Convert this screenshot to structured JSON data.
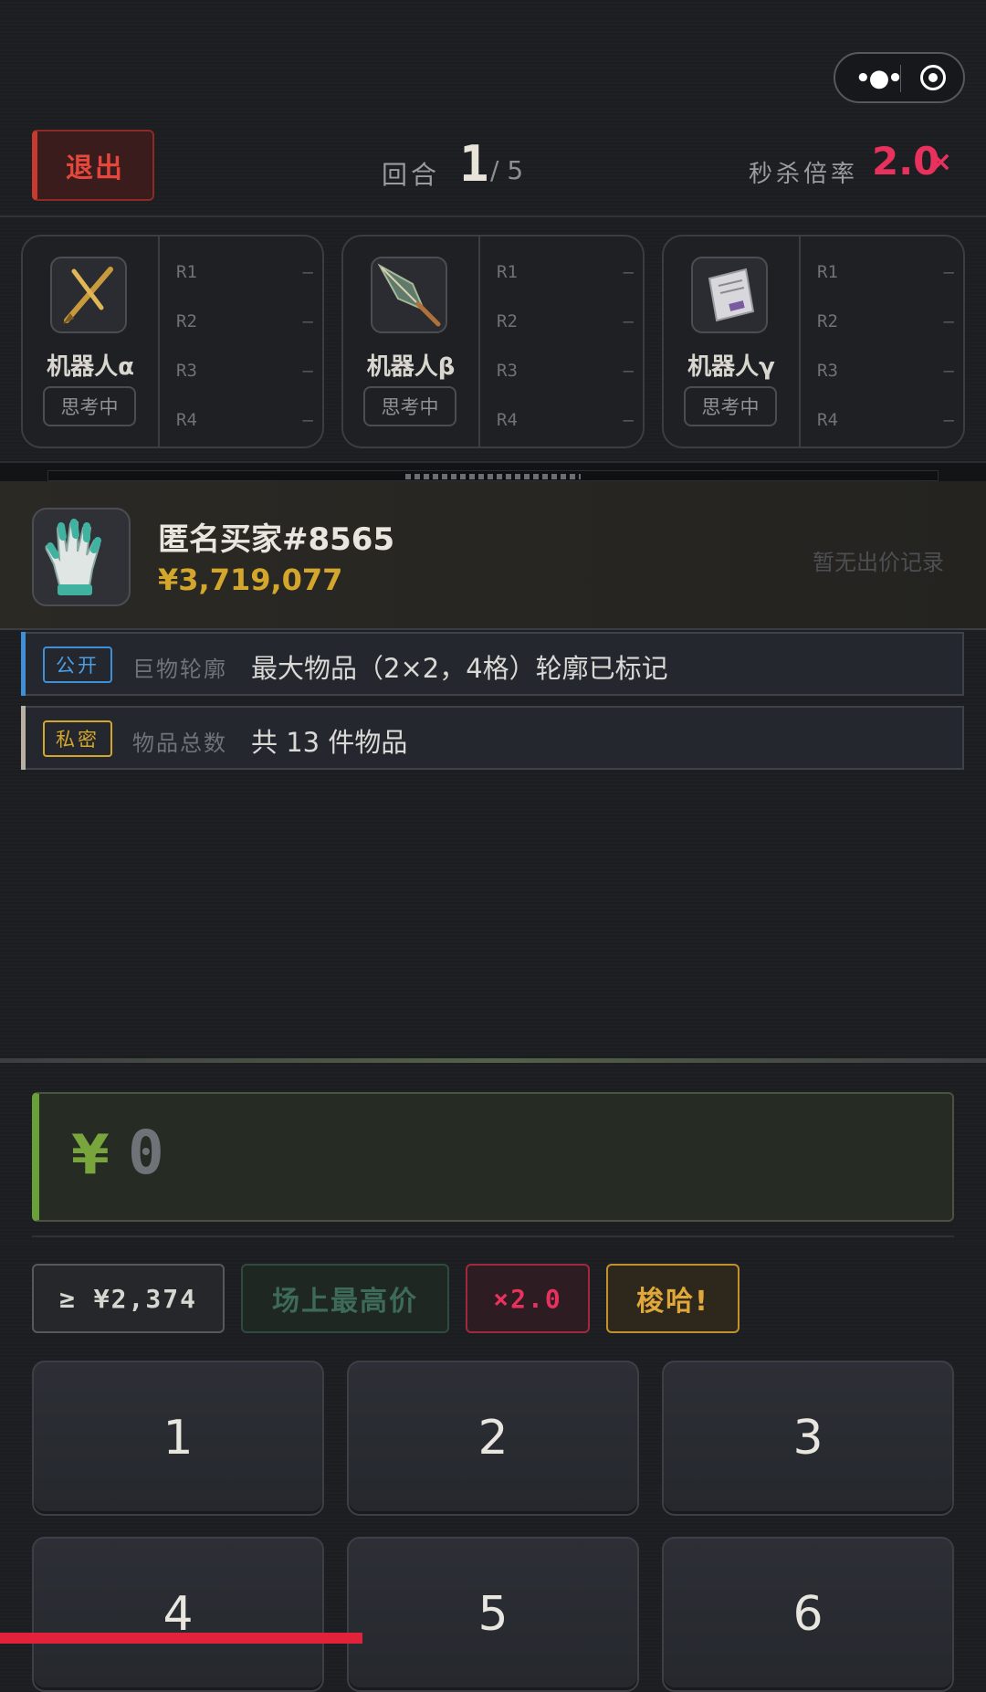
{
  "capsule": {
    "more_icon": "more-dots-icon",
    "target_icon": "target-icon"
  },
  "header": {
    "exit_label": "退出",
    "round_label": "回合",
    "round_current": "1",
    "round_total": "/ 5",
    "rate_label": "秒杀倍率",
    "rate_value": "2.0",
    "rate_suffix": "×"
  },
  "robots": [
    {
      "name": "机器人α",
      "status": "思考中",
      "item_icon": "fountain-pen-icon",
      "rounds": [
        {
          "label": "R1",
          "value": "—"
        },
        {
          "label": "R2",
          "value": "—"
        },
        {
          "label": "R3",
          "value": "—"
        },
        {
          "label": "R4",
          "value": "—"
        }
      ]
    },
    {
      "name": "机器人β",
      "status": "思考中",
      "item_icon": "spearhead-icon",
      "rounds": [
        {
          "label": "R1",
          "value": "—"
        },
        {
          "label": "R2",
          "value": "—"
        },
        {
          "label": "R3",
          "value": "—"
        },
        {
          "label": "R4",
          "value": "—"
        }
      ]
    },
    {
      "name": "机器人γ",
      "status": "思考中",
      "item_icon": "document-bag-icon",
      "rounds": [
        {
          "label": "R1",
          "value": "—"
        },
        {
          "label": "R2",
          "value": "—"
        },
        {
          "label": "R3",
          "value": "—"
        },
        {
          "label": "R4",
          "value": "—"
        }
      ]
    }
  ],
  "buyer": {
    "name": "匿名买家#8565",
    "price": "¥3,719,077",
    "no_bid": "暂无出价记录",
    "item_icon": "glove-icon"
  },
  "info": [
    {
      "tag": "公开",
      "label": "巨物轮廓",
      "text": "最大物品（2×2，4格）轮廓已标记",
      "color": "#3f8fd6"
    },
    {
      "tag": "私密",
      "label": "物品总数",
      "text": "共 13 件物品",
      "color": "#d4a72c"
    }
  ],
  "input": {
    "currency": "¥",
    "value": "0"
  },
  "chips": {
    "min_bid": "≥ ¥2,374",
    "top_price": "场上最高价",
    "multiplier": "×2.0",
    "all_in": "梭哈!"
  },
  "keypad": [
    "1",
    "2",
    "3",
    "4",
    "5",
    "6"
  ],
  "colors": {
    "accent_red": "#e8315c",
    "gold": "#d4a72c",
    "green": "#6aa03a",
    "blue": "#3f8fd6"
  }
}
